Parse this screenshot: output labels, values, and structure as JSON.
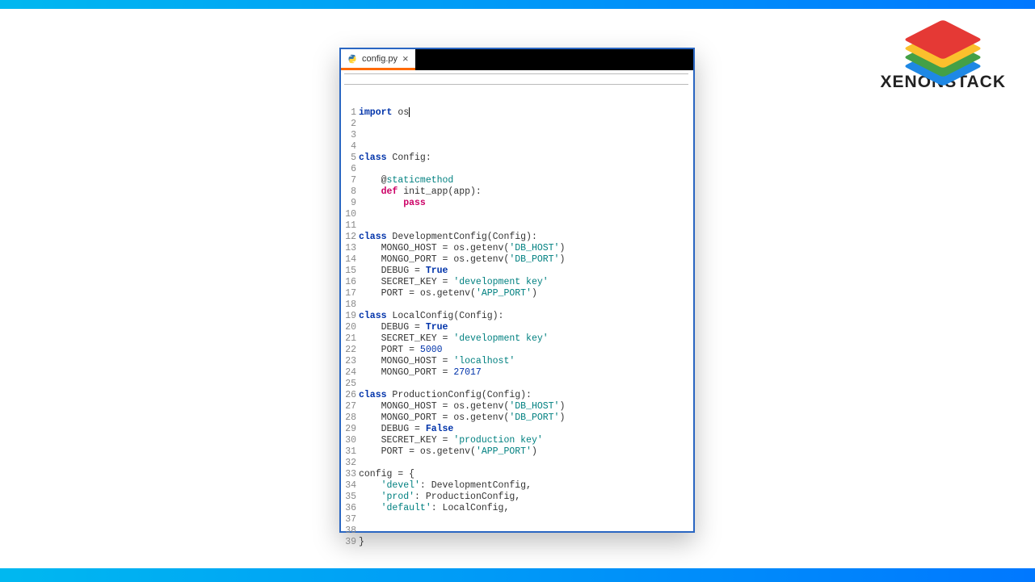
{
  "brand": {
    "name": "XENONSTACK"
  },
  "tab": {
    "filename": "config.py",
    "icon_name": "python-file-icon"
  },
  "code": {
    "lines": [
      {
        "n": 1,
        "tokens": [
          [
            "import ",
            "kw"
          ],
          [
            "os",
            ""
          ]
        ],
        "caret": true
      },
      {
        "n": 2,
        "tokens": []
      },
      {
        "n": 3,
        "tokens": []
      },
      {
        "n": 4,
        "tokens": []
      },
      {
        "n": 5,
        "tokens": [
          [
            "class ",
            "kw"
          ],
          [
            "Config:",
            ""
          ]
        ]
      },
      {
        "n": 6,
        "tokens": []
      },
      {
        "n": 7,
        "tokens": [
          [
            "    @",
            ""
          ],
          [
            "staticmethod",
            "dec"
          ]
        ]
      },
      {
        "n": 8,
        "tokens": [
          [
            "    ",
            ""
          ],
          [
            "def ",
            "kw2"
          ],
          [
            "init_app(app):",
            ""
          ]
        ]
      },
      {
        "n": 9,
        "tokens": [
          [
            "        ",
            ""
          ],
          [
            "pass",
            "kw2"
          ]
        ]
      },
      {
        "n": 10,
        "tokens": []
      },
      {
        "n": 11,
        "tokens": []
      },
      {
        "n": 12,
        "tokens": [
          [
            "class ",
            "kw"
          ],
          [
            "DevelopmentConfig(Config):",
            ""
          ]
        ]
      },
      {
        "n": 13,
        "tokens": [
          [
            "    MONGO_HOST = os.getenv(",
            ""
          ],
          [
            "'DB_HOST'",
            "str"
          ],
          [
            ")",
            ""
          ]
        ]
      },
      {
        "n": 14,
        "tokens": [
          [
            "    MONGO_PORT = os.getenv(",
            ""
          ],
          [
            "'DB_PORT'",
            "str"
          ],
          [
            ")",
            ""
          ]
        ]
      },
      {
        "n": 15,
        "tokens": [
          [
            "    DEBUG = ",
            ""
          ],
          [
            "True",
            "bool"
          ]
        ]
      },
      {
        "n": 16,
        "tokens": [
          [
            "    SECRET_KEY = ",
            ""
          ],
          [
            "'development key'",
            "str"
          ]
        ]
      },
      {
        "n": 17,
        "tokens": [
          [
            "    PORT = os.getenv(",
            ""
          ],
          [
            "'APP_PORT'",
            "str"
          ],
          [
            ")",
            ""
          ]
        ]
      },
      {
        "n": 18,
        "tokens": []
      },
      {
        "n": 19,
        "tokens": [
          [
            "class ",
            "kw"
          ],
          [
            "LocalConfig(Config):",
            ""
          ]
        ]
      },
      {
        "n": 20,
        "tokens": [
          [
            "    DEBUG = ",
            ""
          ],
          [
            "True",
            "bool"
          ]
        ]
      },
      {
        "n": 21,
        "tokens": [
          [
            "    SECRET_KEY = ",
            ""
          ],
          [
            "'development key'",
            "str"
          ]
        ]
      },
      {
        "n": 22,
        "tokens": [
          [
            "    PORT = ",
            ""
          ],
          [
            "5000",
            "num"
          ]
        ]
      },
      {
        "n": 23,
        "tokens": [
          [
            "    MONGO_HOST = ",
            ""
          ],
          [
            "'localhost'",
            "str"
          ]
        ]
      },
      {
        "n": 24,
        "tokens": [
          [
            "    MONGO_PORT = ",
            ""
          ],
          [
            "27017",
            "num"
          ]
        ]
      },
      {
        "n": 25,
        "tokens": []
      },
      {
        "n": 26,
        "tokens": [
          [
            "class ",
            "kw"
          ],
          [
            "ProductionConfig(Config):",
            ""
          ]
        ]
      },
      {
        "n": 27,
        "tokens": [
          [
            "    MONGO_HOST = os.getenv(",
            ""
          ],
          [
            "'DB_HOST'",
            "str"
          ],
          [
            ")",
            ""
          ]
        ]
      },
      {
        "n": 28,
        "tokens": [
          [
            "    MONGO_PORT = os.getenv(",
            ""
          ],
          [
            "'DB_PORT'",
            "str"
          ],
          [
            ")",
            ""
          ]
        ]
      },
      {
        "n": 29,
        "tokens": [
          [
            "    DEBUG = ",
            ""
          ],
          [
            "False",
            "bool"
          ]
        ]
      },
      {
        "n": 30,
        "tokens": [
          [
            "    SECRET_KEY = ",
            ""
          ],
          [
            "'production key'",
            "str"
          ]
        ]
      },
      {
        "n": 31,
        "tokens": [
          [
            "    PORT = os.getenv(",
            ""
          ],
          [
            "'APP_PORT'",
            "str"
          ],
          [
            ")",
            ""
          ]
        ]
      },
      {
        "n": 32,
        "tokens": []
      },
      {
        "n": 33,
        "tokens": [
          [
            "config = {",
            ""
          ]
        ]
      },
      {
        "n": 34,
        "tokens": [
          [
            "    ",
            ""
          ],
          [
            "'devel'",
            "str"
          ],
          [
            ": DevelopmentConfig,",
            ""
          ]
        ]
      },
      {
        "n": 35,
        "tokens": [
          [
            "    ",
            ""
          ],
          [
            "'prod'",
            "str"
          ],
          [
            ": ProductionConfig,",
            ""
          ]
        ]
      },
      {
        "n": 36,
        "tokens": [
          [
            "    ",
            ""
          ],
          [
            "'default'",
            "str"
          ],
          [
            ": LocalConfig,",
            ""
          ]
        ]
      },
      {
        "n": 37,
        "tokens": []
      },
      {
        "n": 38,
        "tokens": []
      },
      {
        "n": 39,
        "tokens": [
          [
            "}",
            ""
          ]
        ]
      }
    ]
  }
}
